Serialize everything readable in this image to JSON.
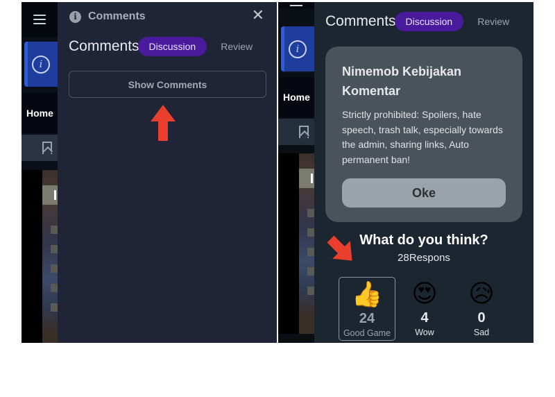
{
  "left_screen": {
    "background_app": {
      "nav_home_label": "Home",
      "icons": [
        "hamburger-menu-icon",
        "info-icon",
        "bookmark-icon"
      ]
    },
    "panel": {
      "header_title": "Comments",
      "header_icon": "info-icon",
      "close_icon": "close-icon",
      "close_glyph": "✕",
      "tabs_title": "Comments",
      "tabs": [
        {
          "label": "Discussion",
          "active": true
        },
        {
          "label": "Review",
          "active": false
        }
      ],
      "show_comments_label": "Show Comments"
    },
    "annotation": {
      "type": "arrow-up",
      "color": "#e8402c"
    }
  },
  "right_screen": {
    "background_app": {
      "nav_home_label": "Home"
    },
    "tabs_title": "Comments",
    "tabs": [
      {
        "label": "Discussion",
        "active": true
      },
      {
        "label": "Review",
        "active": false
      }
    ],
    "dialog": {
      "title": "Nimemob Kebijakan Komentar",
      "body": "Strictly prohibited: Spoilers, hate speech, trash talk, especially towards the admin, sharing links, Auto permanent ban!",
      "ok_label": "Oke"
    },
    "poll": {
      "question": "What do you think?",
      "responses_label": "28Respons",
      "reactions": [
        {
          "emoji": "👍",
          "icon": "thumbs-up-icon",
          "count": "24",
          "label": "Good Game",
          "selected": true
        },
        {
          "emoji": "😍",
          "icon": "heart-eyes-icon",
          "count": "4",
          "label": "Wow",
          "selected": false
        },
        {
          "emoji": "😥",
          "icon": "sad-face-icon",
          "count": "0",
          "label": "Sad",
          "selected": false
        }
      ]
    },
    "annotation": {
      "type": "arrow-diagonal",
      "color": "#e8402c"
    }
  },
  "colors": {
    "pill_active": "#4a1a9c",
    "panel_left_bg": "#1f2536",
    "panel_right_bg": "#1c2630",
    "dialog_bg": "#4a535c",
    "ok_button_bg": "#9ba3ab",
    "annotation_red": "#e8402c",
    "sidebar_active_blue": "#1f3d9c"
  }
}
